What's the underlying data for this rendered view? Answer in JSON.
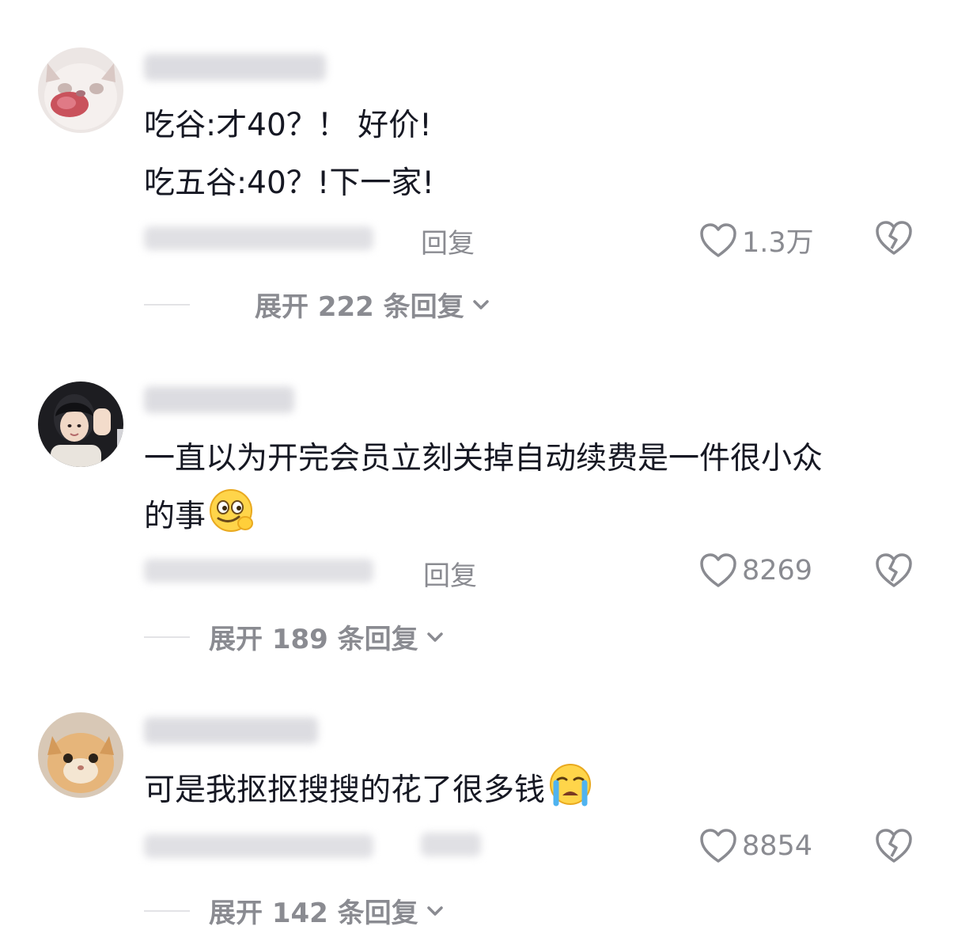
{
  "comments": [
    {
      "lines": [
        "吃谷:才40？！ 好价!",
        "吃五谷:40？!下一家!"
      ],
      "reply_label": "回复",
      "likes": "1.3万",
      "expand_label": "展开 222 条回复",
      "avatar_icon": "cat-face-avatar-icon",
      "emoji_icon": null
    },
    {
      "lines": [
        "一直以为开完会员立刻关掉自动续费是一件很小众",
        "的事"
      ],
      "reply_label": "回复",
      "likes": "8269",
      "expand_label": "展开 189 条回复",
      "avatar_icon": "person-waving-avatar-icon",
      "emoji_icon": "smirk-emoji-icon"
    },
    {
      "lines": [
        "可是我抠抠搜搜的花了很多钱"
      ],
      "reply_label": "",
      "likes": "8854",
      "expand_label": "展开 142 条回复",
      "avatar_icon": "orange-cat-avatar-icon",
      "emoji_icon": "crying-emoji-icon"
    }
  ],
  "colors": {
    "text_primary": "#161823",
    "text_secondary": "#8a8b91",
    "background": "#ffffff"
  }
}
